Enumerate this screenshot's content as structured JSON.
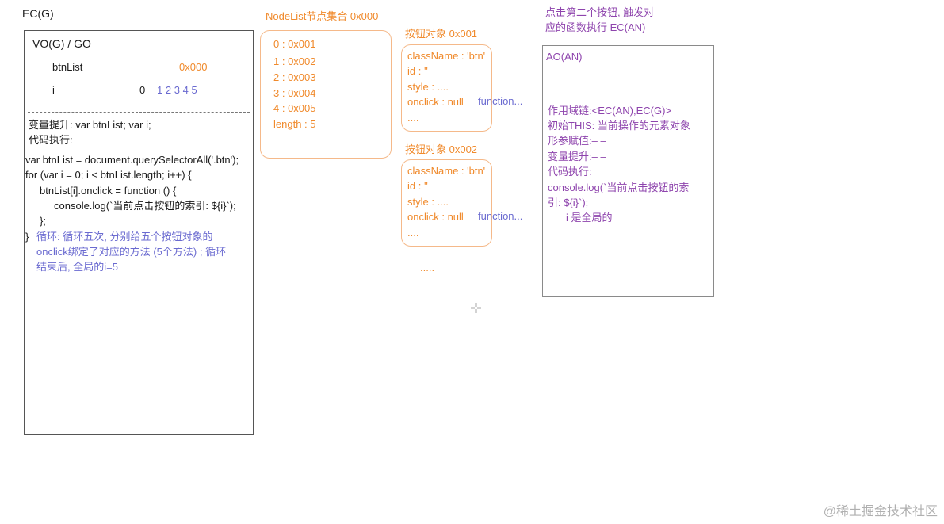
{
  "ec_label": "EC(G)",
  "global": {
    "vo_title": "VO(G) / GO",
    "btnlist_var": "btnList",
    "btnlist_addr": "0x000",
    "i_var": "i",
    "i_current": "0",
    "i_history": [
      "1",
      "2",
      "3",
      "4"
    ],
    "i_final": "5",
    "hoist": "变量提升: var btnList;    var i;",
    "exec_title": "代码执行:",
    "code": [
      "var btnList = document.querySelectorAll('.btn');",
      "for (var i = 0; i < btnList.length; i++) {",
      "btnList[i].onclick = function () {",
      "console.log(`当前点击按钮的索引: ${i}`);",
      "};"
    ],
    "closing_brace": "}",
    "loop_note": [
      "循环: 循环五次, 分别给五个按钮对象的",
      "onclick绑定了对应的方法 (5个方法) ; 循环",
      "结束后, 全局的i=5"
    ]
  },
  "nodelist": {
    "title": "NodeList节点集合  0x000",
    "items": [
      "0 :   0x001",
      "1 : 0x002",
      "2 : 0x003",
      "3 : 0x004",
      "4 : 0x005",
      "length : 5"
    ]
  },
  "btn1": {
    "title": "按钮对象 0x001",
    "props": [
      "className : 'btn'",
      "id : ''",
      "style : ....",
      "onclick : null",
      "...."
    ],
    "fn": "function..."
  },
  "btn2": {
    "title": "按钮对象 0x002",
    "props": [
      "className : 'btn'",
      "id : ''",
      "style : ....",
      "onclick : null",
      "...."
    ],
    "fn": "function..."
  },
  "more": ".....",
  "click_note": [
    "点击第二个按钮, 触发对",
    "应的函数执行  EC(AN)"
  ],
  "ao": {
    "title": "AO(AN)",
    "lines": [
      "作用域链:<EC(AN),EC(G)>",
      "初始THIS: 当前操作的元素对象",
      "形参赋值:– –",
      "变量提升:– –",
      "代码执行:",
      "console.log(`当前点击按钮的索",
      "引: ${i}`);",
      "i 是全局的"
    ]
  },
  "watermark": "@稀土掘金技术社区"
}
